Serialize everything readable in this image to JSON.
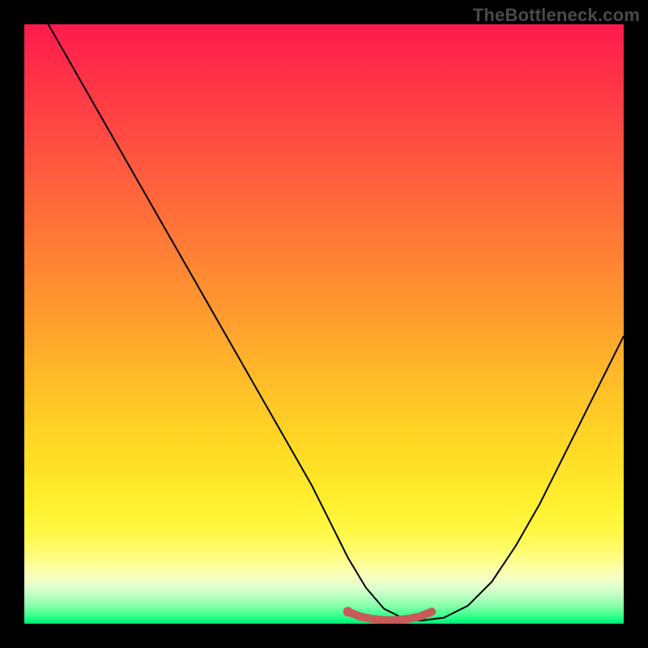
{
  "watermark": "TheBottleneck.com",
  "chart_data": {
    "type": "line",
    "title": "",
    "xlabel": "",
    "ylabel": "",
    "xlim": [
      0,
      100
    ],
    "ylim": [
      0,
      100
    ],
    "background_gradient": {
      "direction": "vertical",
      "stops": [
        {
          "pos": 0,
          "color": "#ff1a4d"
        },
        {
          "pos": 0.5,
          "color": "#ff9a2f"
        },
        {
          "pos": 0.8,
          "color": "#fff232"
        },
        {
          "pos": 0.92,
          "color": "#f3ffc4"
        },
        {
          "pos": 1.0,
          "color": "#00e878"
        }
      ]
    },
    "series": [
      {
        "name": "bottleneck-curve",
        "x": [
          4,
          8,
          12,
          16,
          20,
          24,
          28,
          32,
          36,
          40,
          44,
          48,
          51,
          54,
          57,
          60,
          63,
          66,
          70,
          74,
          78,
          82,
          86,
          90,
          94,
          98,
          100
        ],
        "y": [
          100,
          93,
          86,
          79,
          72,
          65,
          58,
          51,
          44,
          37,
          30,
          23,
          17,
          11,
          6,
          2.5,
          1,
          0.5,
          1,
          3,
          7,
          13,
          20,
          28,
          36,
          44,
          48
        ],
        "stroke": "#000000"
      }
    ],
    "annotations": [
      {
        "name": "valley-highlight",
        "type": "polyline",
        "x": [
          54,
          56,
          58,
          60,
          62,
          64,
          66,
          68
        ],
        "y": [
          2.0,
          1.2,
          0.8,
          0.6,
          0.6,
          0.8,
          1.2,
          2.0
        ],
        "stroke": "#c85a5a",
        "stroke_width": 10
      },
      {
        "name": "valley-start-dot",
        "type": "dot",
        "x": 54,
        "y": 2.0,
        "r": 6,
        "fill": "#c85a5a"
      }
    ]
  }
}
